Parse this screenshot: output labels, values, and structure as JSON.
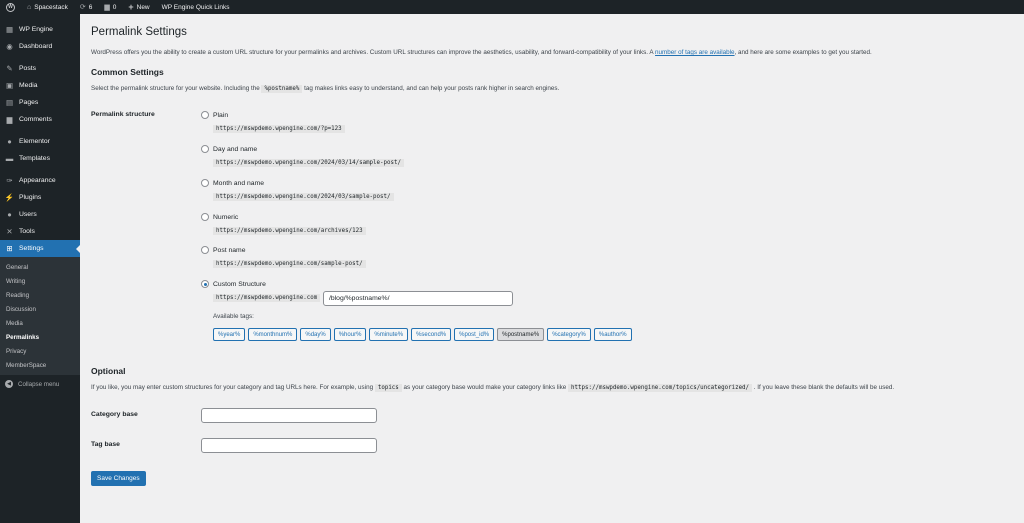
{
  "adminbar": {
    "site_name": "Spacestack",
    "updates_count": "6",
    "comments_count": "0",
    "new_label": "New",
    "quick_links": "WP Engine Quick Links"
  },
  "sidebar": {
    "items": [
      {
        "label": "WP Engine",
        "icon": "wpengine-icon"
      },
      {
        "label": "Dashboard",
        "icon": "dashboard-icon"
      },
      {
        "label": "Posts",
        "icon": "pin-icon"
      },
      {
        "label": "Media",
        "icon": "media-icon"
      },
      {
        "label": "Pages",
        "icon": "page-icon"
      },
      {
        "label": "Comments",
        "icon": "comment-icon"
      },
      {
        "label": "Elementor",
        "icon": "elementor-icon"
      },
      {
        "label": "Templates",
        "icon": "folder-icon"
      },
      {
        "label": "Appearance",
        "icon": "brush-icon"
      },
      {
        "label": "Plugins",
        "icon": "plug-icon"
      },
      {
        "label": "Users",
        "icon": "user-icon"
      },
      {
        "label": "Tools",
        "icon": "wrench-icon"
      },
      {
        "label": "Settings",
        "icon": "settings-icon"
      }
    ],
    "submenu": [
      "General",
      "Writing",
      "Reading",
      "Discussion",
      "Media",
      "Permalinks",
      "Privacy",
      "MemberSpace"
    ],
    "collapse_label": "Collapse menu"
  },
  "page": {
    "title": "Permalink Settings",
    "intro_before": "WordPress offers you the ability to create a custom URL structure for your permalinks and archives. Custom URL structures can improve the aesthetics, usability, and forward-compatibility of your links. A ",
    "intro_link": "number of tags are available",
    "intro_after": ", and here are some examples to get you started.",
    "common_heading": "Common Settings",
    "common_desc_before": "Select the permalink structure for your website. Including the ",
    "common_desc_code": "%postname%",
    "common_desc_after": " tag makes links easy to understand, and can help your posts rank higher in search engines.",
    "structure_label": "Permalink structure",
    "options": [
      {
        "label": "Plain",
        "example": "https://mswpdemo.wpengine.com/?p=123"
      },
      {
        "label": "Day and name",
        "example": "https://mswpdemo.wpengine.com/2024/03/14/sample-post/"
      },
      {
        "label": "Month and name",
        "example": "https://mswpdemo.wpengine.com/2024/03/sample-post/"
      },
      {
        "label": "Numeric",
        "example": "https://mswpdemo.wpengine.com/archives/123"
      },
      {
        "label": "Post name",
        "example": "https://mswpdemo.wpengine.com/sample-post/"
      },
      {
        "label": "Custom Structure",
        "example": "https://mswpdemo.wpengine.com"
      }
    ],
    "custom_value": "/blog/%postname%/",
    "available_tags_label": "Available tags:",
    "tags": [
      "%year%",
      "%monthnum%",
      "%day%",
      "%hour%",
      "%minute%",
      "%second%",
      "%post_id%",
      "%postname%",
      "%category%",
      "%author%"
    ],
    "optional_heading": "Optional",
    "optional_desc_before": "If you like, you may enter custom structures for your category and tag URLs here. For example, using ",
    "optional_desc_code1": "topics",
    "optional_desc_mid": " as your category base would make your category links like ",
    "optional_desc_code2": "https://mswpdemo.wpengine.com/topics/uncategorized/",
    "optional_desc_after": " . If you leave these blank the defaults will be used.",
    "category_base_label": "Category base",
    "tag_base_label": "Tag base",
    "save_label": "Save Changes"
  }
}
